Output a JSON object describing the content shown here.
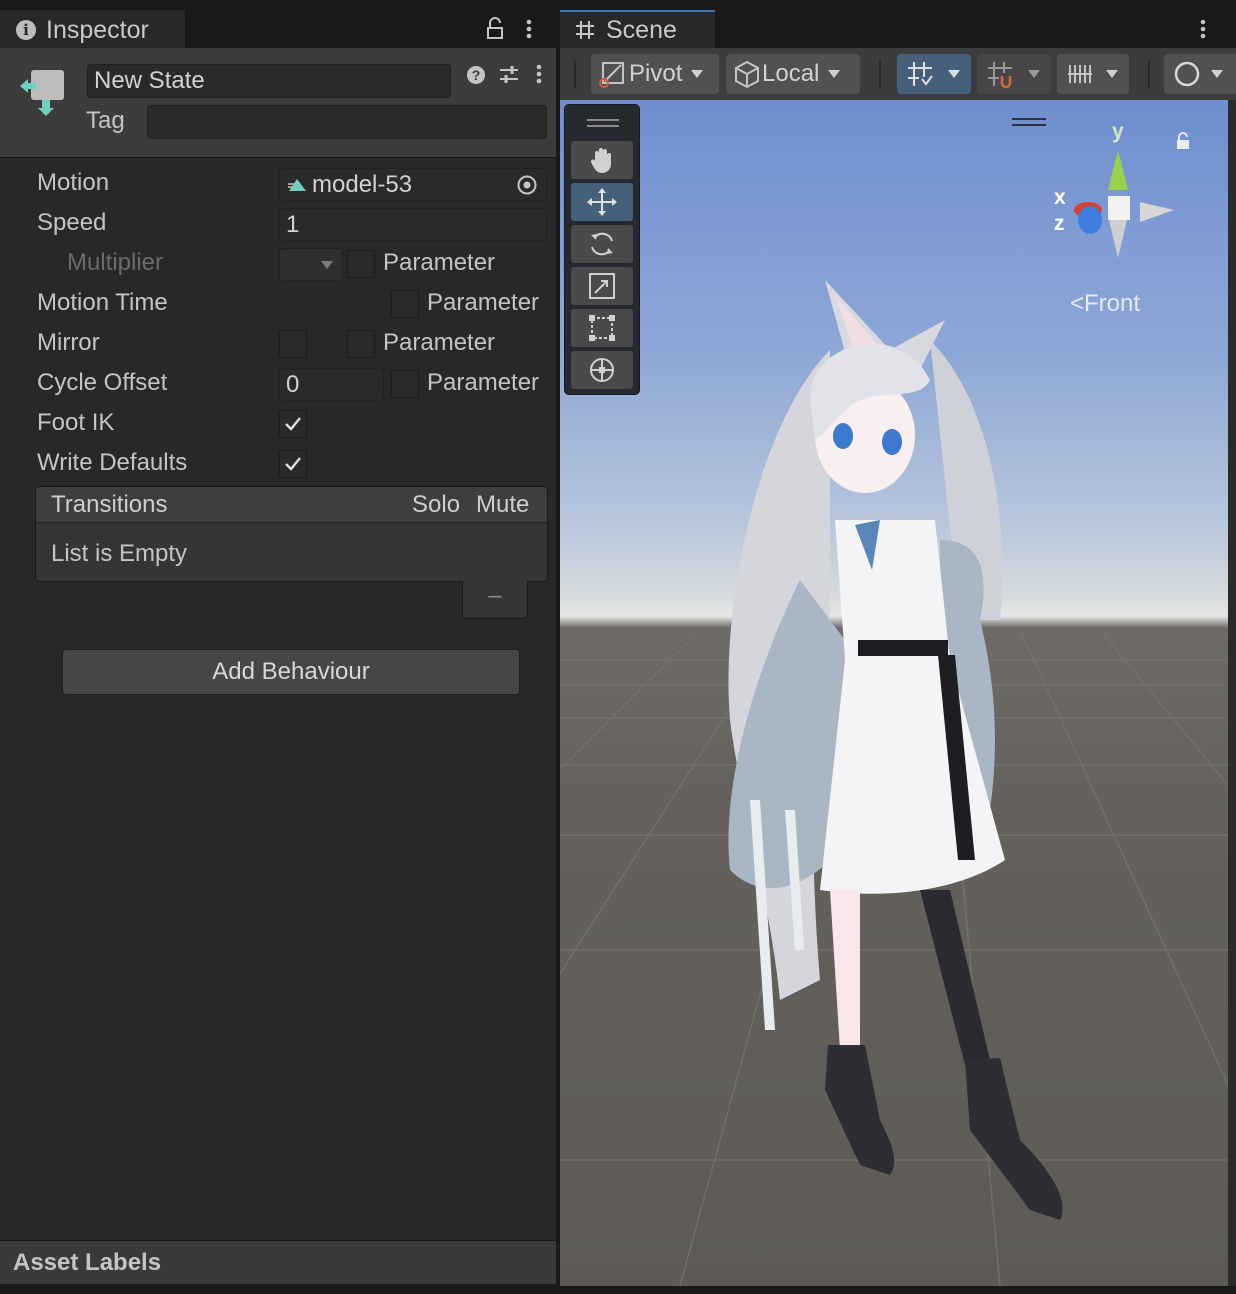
{
  "inspector": {
    "tab_label": "Inspector",
    "icon": "info-icon",
    "state_name": "New State",
    "tag_label": "Tag",
    "tag_value": "",
    "fields": {
      "motion_label": "Motion",
      "motion_value": "model-53",
      "speed_label": "Speed",
      "speed_value": "1",
      "multiplier_label": "Multiplier",
      "parameter_label": "Parameter",
      "motion_time_label": "Motion Time",
      "mirror_label": "Mirror",
      "cycle_offset_label": "Cycle Offset",
      "cycle_offset_value": "0",
      "foot_ik_label": "Foot IK",
      "foot_ik_checked": true,
      "write_defaults_label": "Write Defaults",
      "write_defaults_checked": true
    },
    "transitions": {
      "title": "Transitions",
      "solo_label": "Solo",
      "mute_label": "Mute",
      "empty_text": "List is Empty",
      "remove_label": "–"
    },
    "add_behaviour_label": "Add Behaviour",
    "asset_labels": "Asset Labels"
  },
  "scene": {
    "tab_label": "Scene",
    "pivot_label": "Pivot",
    "local_label": "Local",
    "gizmo": {
      "y": "y",
      "x": "x",
      "z": "z",
      "view_label": "Front"
    }
  },
  "colors": {
    "panel_bg": "#282828",
    "header_bg": "#3c3c3c",
    "accent_blue": "#3a79bb",
    "selected_tool": "#46607c",
    "gizmo_y": "#9ad14b",
    "gizmo_x": "#d8412f",
    "gizmo_z": "#3d7fe0"
  }
}
